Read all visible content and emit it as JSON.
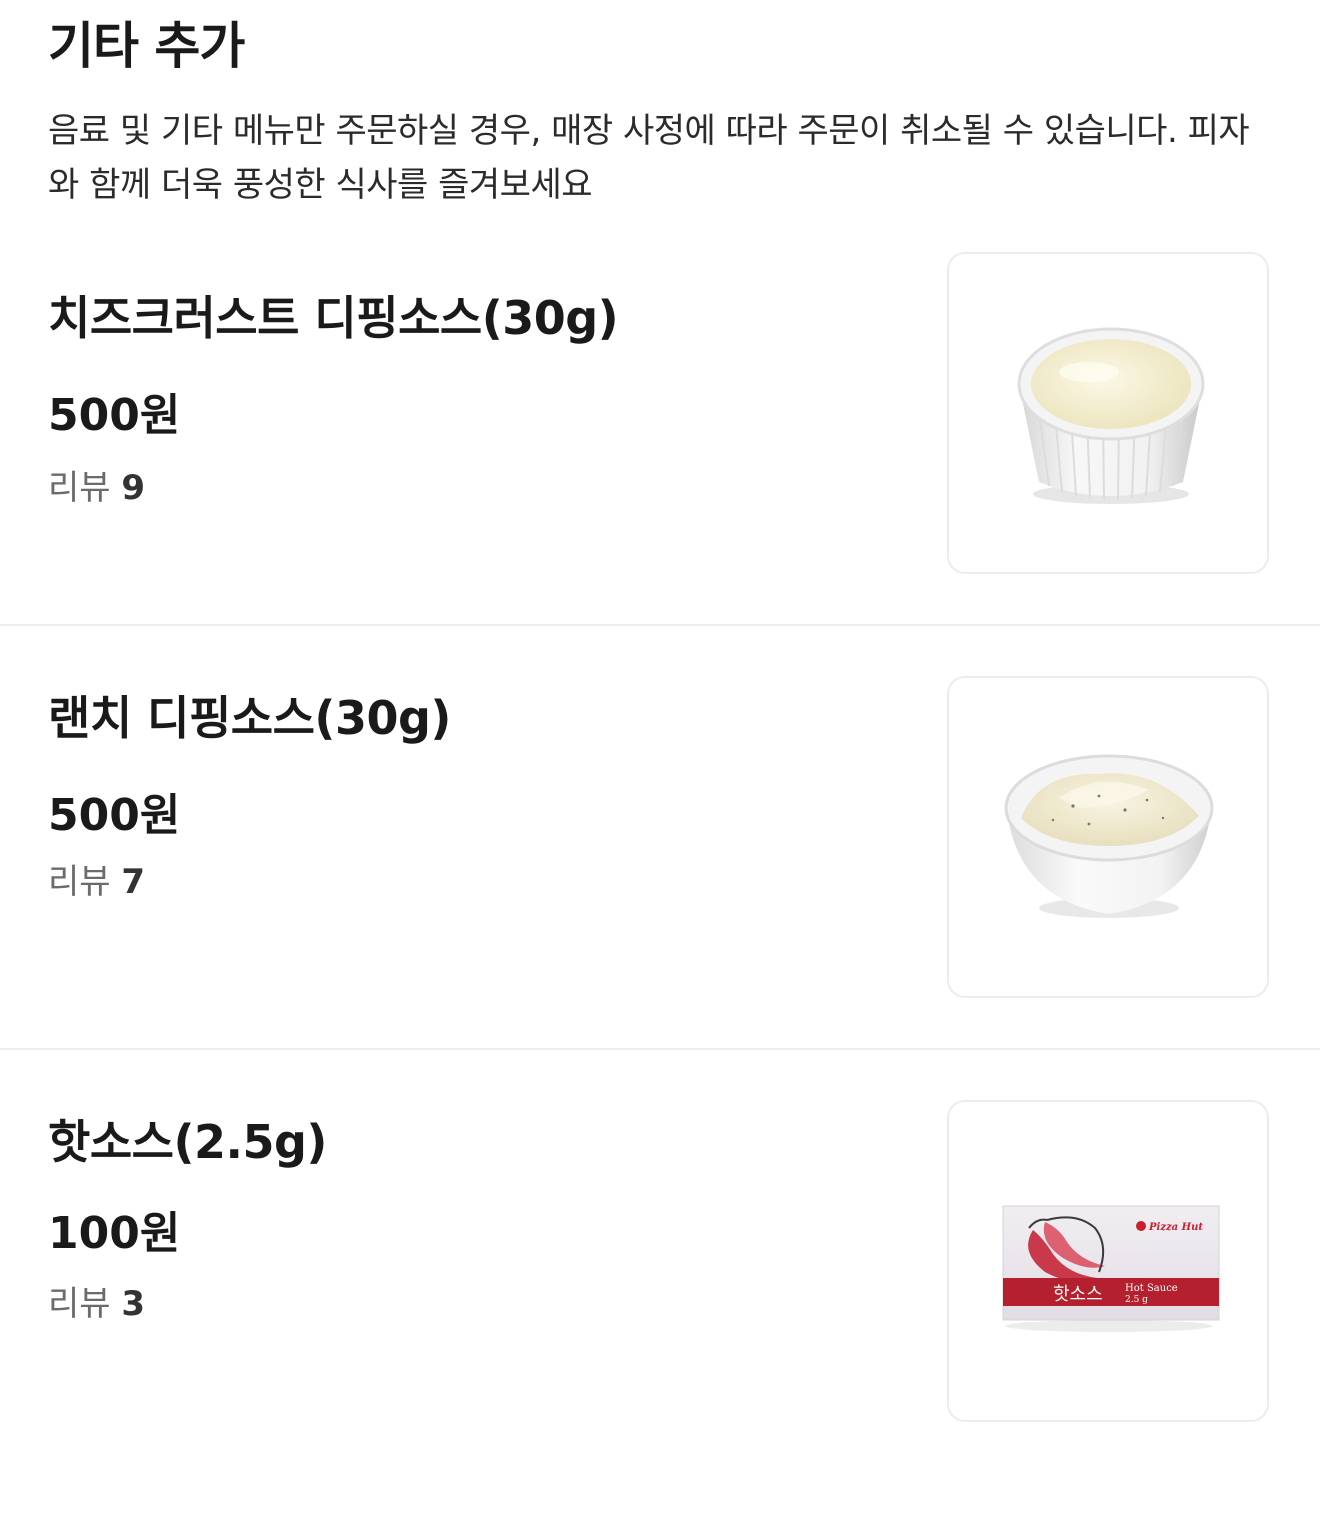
{
  "section": {
    "title": "기타 추가",
    "description": "음료 및 기타 메뉴만 주문하실 경우, 매장 사정에 따라 주문이 취소될 수 있습니다. 피자와 함께 더욱 풍성한 식사를 즐겨보세요"
  },
  "review_label": "리뷰",
  "items": [
    {
      "name": "치즈크러스트 디핑소스(30g)",
      "price": "500원",
      "review_count": "9",
      "image": "cheese-crust-dipping-sauce-image"
    },
    {
      "name": "랜치 디핑소스(30g)",
      "price": "500원",
      "review_count": "7",
      "image": "ranch-dipping-sauce-image"
    },
    {
      "name": "핫소스(2.5g)",
      "price": "100원",
      "review_count": "3",
      "image": "hot-sauce-packet-image",
      "packet": {
        "brand": "Pizza Hut",
        "korean_label": "핫소스",
        "english_label": "Hot Sauce",
        "weight": "2.5 g"
      }
    }
  ],
  "colors": {
    "title_text": "#1a1a1a",
    "review_text": "#6b6b6b",
    "divider": "#efefef",
    "thumb_border": "#ececec",
    "packet_red": "#b5202e"
  }
}
